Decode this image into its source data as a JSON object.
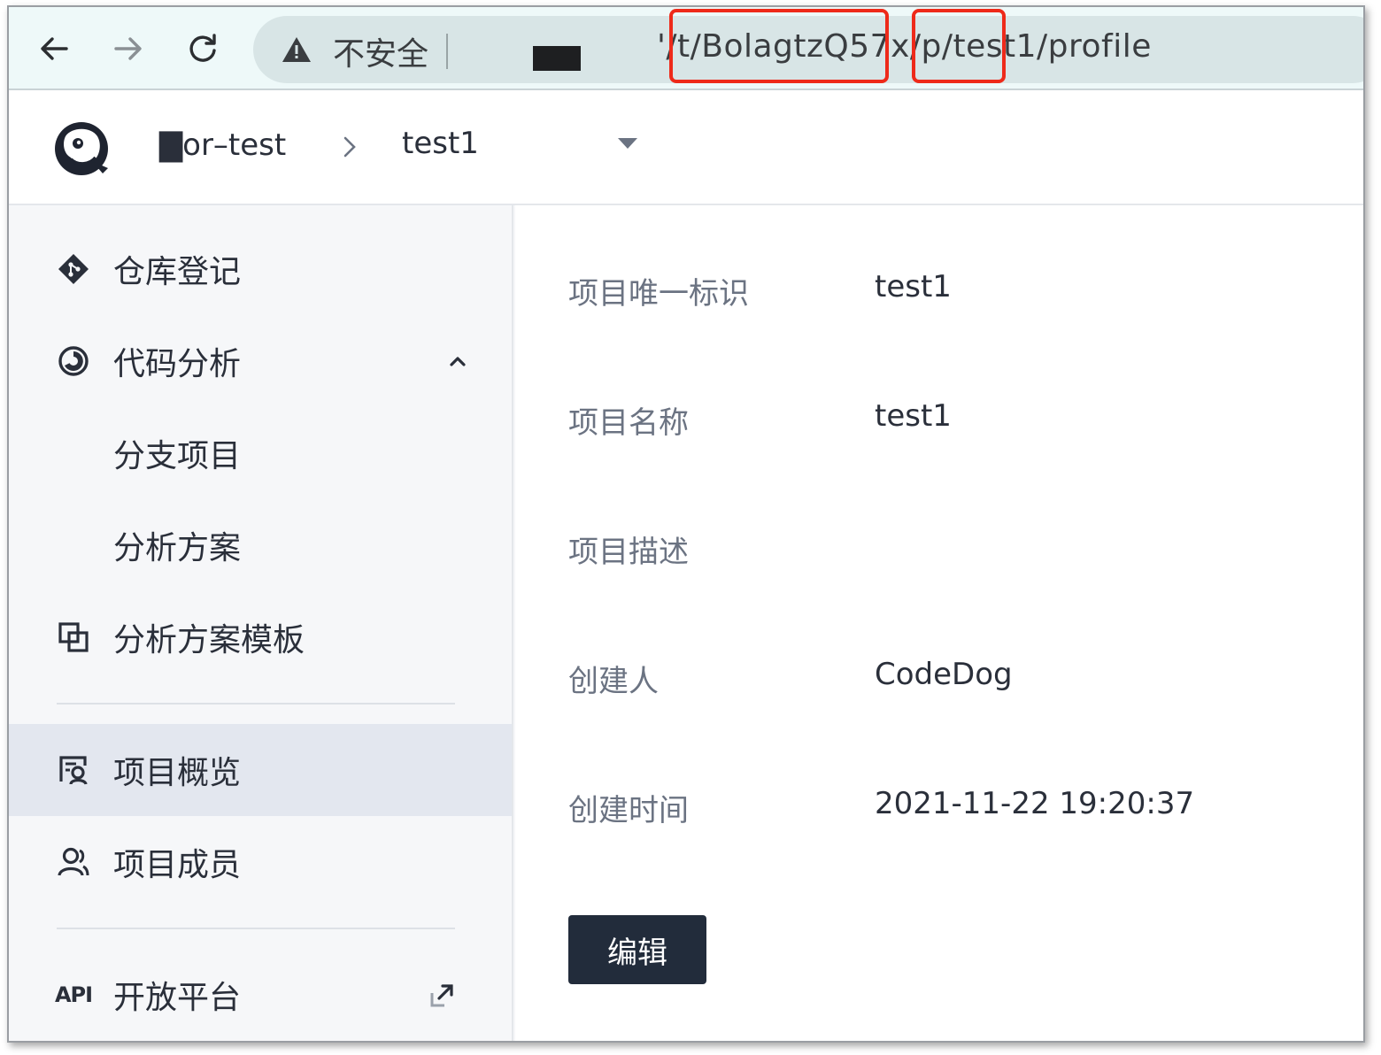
{
  "browser": {
    "security_text": "不安全",
    "url": "'/t/BolagtzQ57x/p/test1/profile",
    "icons": [
      "back-arrow-icon",
      "forward-arrow-icon",
      "reload-icon",
      "warning-triangle-icon"
    ]
  },
  "header": {
    "org_name": "▇or–test",
    "project_name": "test1",
    "icons": [
      "logo-icon",
      "chevron-right-icon",
      "caret-down-icon"
    ]
  },
  "sidebar": {
    "items": [
      {
        "label": "仓库登记",
        "icon": "repo-diamond-icon"
      },
      {
        "label": "代码分析",
        "icon": "analysis-gauge-icon",
        "expanded": true
      },
      {
        "label": "分支项目"
      },
      {
        "label": "分析方案"
      },
      {
        "label": "分析方案模板",
        "icon": "template-icon"
      },
      {
        "label": "项目概览",
        "icon": "overview-icon",
        "active": true
      },
      {
        "label": "项目成员",
        "icon": "user-icon"
      },
      {
        "label": "开放平台",
        "icon_text": "API",
        "external": true
      }
    ]
  },
  "profile": {
    "fields": [
      {
        "label": "项目唯一标识",
        "value": "test1"
      },
      {
        "label": "项目名称",
        "value": "test1"
      },
      {
        "label": "项目描述",
        "value": ""
      },
      {
        "label": "创建人",
        "value": "CodeDog"
      },
      {
        "label": "创建时间",
        "value": "2021-11-22 19:20:37"
      }
    ],
    "edit_button": "编辑"
  },
  "colors": {
    "highlight_box": "#ee2a1a",
    "primary_button": "#222c3b",
    "active_item_bg": "#e3e7ef"
  }
}
